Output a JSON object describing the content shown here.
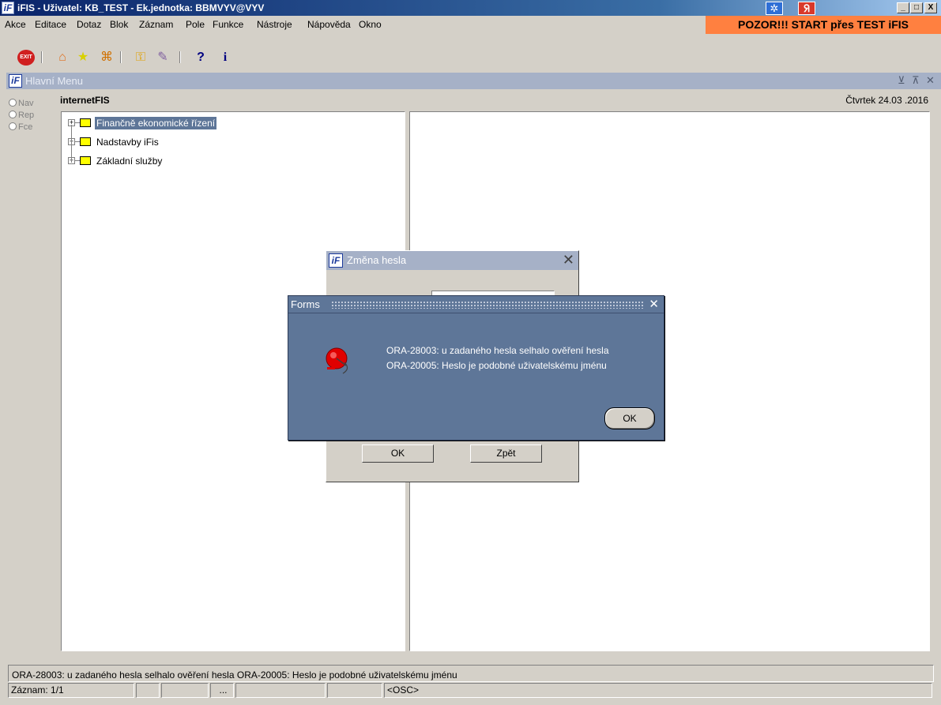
{
  "window": {
    "title": "iFIS - Uživatel: KB_TEST - Ek.jednotka: BBMVYV@VYV",
    "app_icon": "iF",
    "controls": [
      "_",
      "□",
      "X"
    ]
  },
  "menu": {
    "items": [
      "Akce",
      "Editace",
      "Dotaz",
      "Blok",
      "Záznam",
      "Pole",
      "Funkce",
      "Nástroje",
      "Nápověda",
      "Okno"
    ],
    "warning": "POZOR!!! START přes TEST iFIS"
  },
  "toolbar": {
    "exit_label": "EXIT",
    "icons": [
      "exit-icon",
      "home-icon",
      "star-icon",
      "network-icon",
      "key-icon",
      "wand-icon",
      "help-icon",
      "info-icon"
    ]
  },
  "main_window": {
    "title": "Hlavní Menu",
    "controls": [
      "⊻",
      "⊼",
      "✕"
    ],
    "radio_options": [
      "Nav",
      "Rep",
      "Fce"
    ],
    "app_label": "internetFIS",
    "date": "Čtvrtek 24.03 .2016"
  },
  "tree": {
    "items": [
      {
        "label": "Finančně ekonomické řízení",
        "selected": true
      },
      {
        "label": "Nadstavby iFis",
        "selected": false
      },
      {
        "label": "Základní služby",
        "selected": false
      }
    ]
  },
  "zmena_dialog": {
    "title": "Změna hesla",
    "ok_label": "OK",
    "back_label": "Zpět"
  },
  "forms_alert": {
    "title": "Forms",
    "message_line_1": "ORA-28003: u zadaného hesla selhalo ověření hesla",
    "message_line_2": "ORA-20005: Heslo je podobné uživatelskému jménu",
    "ok_label": "OK"
  },
  "statusbar": {
    "message": "ORA-28003: u zadaného hesla selhalo ověření hesla ORA-20005: Heslo je podobné uživatelskému jménu",
    "record": "Záznam: 1/1",
    "cell_dots": "...",
    "osc": "<OSC>"
  },
  "colors": {
    "warning_bg": "#ff8040",
    "dialog_bg": "#5e7698",
    "selection_bg": "#5e7698",
    "titlebar": "#0a246a"
  }
}
